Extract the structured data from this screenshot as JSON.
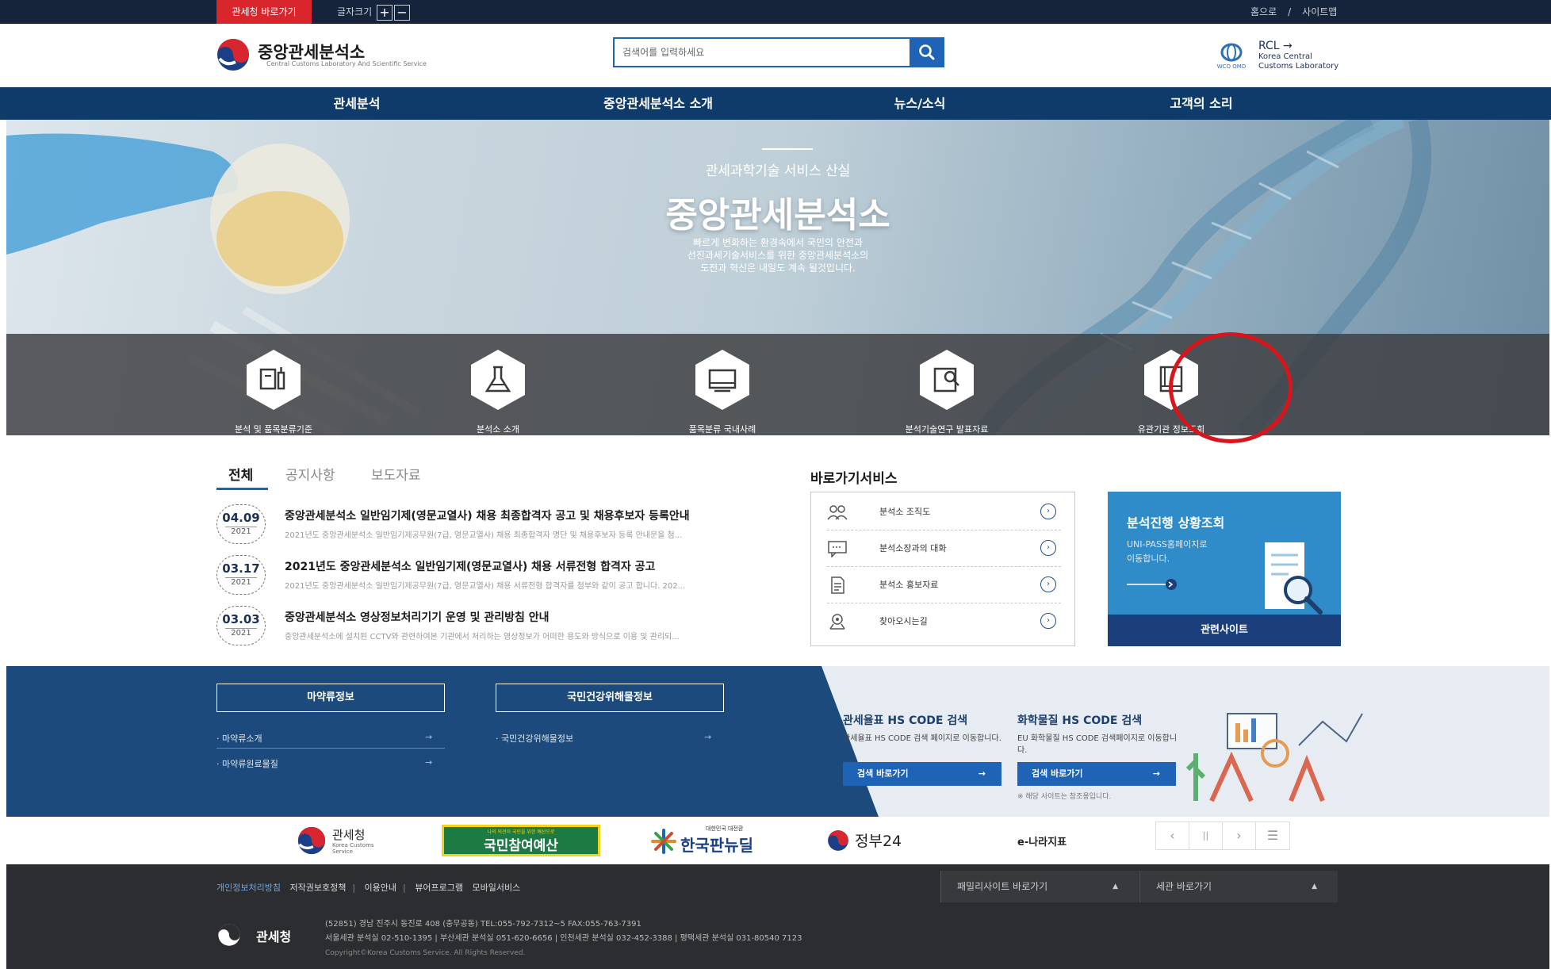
{
  "topbar": {
    "skip_label": "관세청 바로가기",
    "font_size_label": "글자크기",
    "font_plus": "+",
    "font_minus": "−",
    "home_label": "홈으로",
    "separator": "/",
    "sitemap_label": "사이트맵"
  },
  "header": {
    "logo_name": "중앙관세분석소",
    "logo_eng": "Central Customs Laboratory And Scientific Service",
    "search_placeholder": "검색어를 입력하세요",
    "rcl_title": "RCL →",
    "rcl_line1": "Korea Central",
    "rcl_line2": "Customs Laboratory",
    "wco_label": "WCO OMD"
  },
  "gnb": [
    "관세분석",
    "중앙관세분석소 소개",
    "뉴스/소식",
    "고객의 소리"
  ],
  "hero": {
    "subtitle": "관세과학기술 서비스 산실",
    "title": "중앙관세분석소",
    "desc": [
      "빠르게 변화하는 환경속에서 국민의 안전과",
      "선진과세기술서비스를 위한 중앙관세분석소의",
      "도전과 혁신은 내일도 계속 될것입니다."
    ]
  },
  "quick_menu": [
    {
      "label": "분석 및 품목분류기준",
      "icon": "document-bottle-icon"
    },
    {
      "label": "분석소 소개",
      "icon": "flask-icon"
    },
    {
      "label": "품목분류 국내사례",
      "icon": "monitor-icon"
    },
    {
      "label": "분석기술연구 발표자료",
      "icon": "search-document-icon"
    },
    {
      "label": "유관기관 정보조회",
      "icon": "book-icon"
    }
  ],
  "news": {
    "tabs": [
      "전체",
      "공지사항",
      "보도자료"
    ],
    "items": [
      {
        "md": "04.09",
        "year": "2021",
        "title": "중앙관세분석소 일반임기제(영문교열사) 채용 최종합격자 공고 및 채용후보자 등록안내",
        "desc": "2021년도 중앙관세분석소 일반임기제공무원(7급, 영문교열사) 채용 최종합격자 명단 및 채용후보자 등록 안내문을 첨..."
      },
      {
        "md": "03.17",
        "year": "2021",
        "title": "2021년도 중앙관세분석소 일반임기제(영문교열사) 채용 서류전형 합격자 공고",
        "desc": "2021년도 중앙관세분석소 일반임기제공무원(7급, 영문교열사) 채용 서류전형 합격자를 첨부와 같이 공고 합니다. 202..."
      },
      {
        "md": "03.03",
        "year": "2021",
        "title": "중앙관세분석소 영상정보처리기기 운영 및 관리방침 안내",
        "desc": "중앙관세분석소에 설치된 CCTV와 관련하여본 기관에서 처리하는 영상정보가 어떠한 용도와 방식으로 이용 및 관리되..."
      }
    ]
  },
  "shortcut": {
    "title": "바로가기서비스",
    "items": [
      {
        "label": "분석소 조직도",
        "icon": "people-icon"
      },
      {
        "label": "분석소장과의 대화",
        "icon": "chat-icon"
      },
      {
        "label": "분석소 홍보자료",
        "icon": "document-icon"
      },
      {
        "label": "찾아오시는길",
        "icon": "location-icon"
      }
    ],
    "arrow": "›"
  },
  "analysis": {
    "title": "분석진행 상황조회",
    "desc1": "UNI-PASS홈페이지로",
    "desc2": "이동합니다.",
    "button": "관련사이트"
  },
  "band": {
    "drug_title": "마약류정보",
    "drug_links": [
      "마약류소개",
      "마약류원료물질"
    ],
    "health_title": "국민건강위해물정보",
    "health_links": [
      "국민건강위해물정보"
    ],
    "arrow": "→",
    "hs1_title_a": "관세율표 ",
    "hs1_title_b": "HS CODE",
    "hs1_title_c": " 검색",
    "hs1_desc": "관세율표 HS CODE 검색 페이지로 이동합니다.",
    "hs2_title_a": "화학물질 ",
    "hs2_title_b": "HS CODE",
    "hs2_title_c": " 검색",
    "hs2_desc": "EU 화학물질 HS CODE 검색페이지로 이동합니다.",
    "search_btn": "검색 바로가기",
    "note": "※ 해당 사이트는 참조용입니다."
  },
  "partners": {
    "customs_name": "관세청",
    "customs_eng": "Korea Customs Service",
    "budget": "국민참여예산",
    "budget_sub": "나의 의견이 국민을 위한 예산으로",
    "newdeal": "한국판뉴딜",
    "newdeal_sub": "대한민국 대전환",
    "gov24": "정부24",
    "index": "e-나라지표",
    "ctrl_prev": "‹",
    "ctrl_pause": "||",
    "ctrl_next": "›",
    "ctrl_menu": "☰"
  },
  "footer": {
    "links": [
      "개인정보처리방침",
      "저작권보호정책",
      "이용안내",
      "뷰어프로그램",
      "모바일서비스"
    ],
    "sep": "|",
    "family": "패밀리사이트 바로가기",
    "customs": "세관 바로가기",
    "tri": "▲",
    "logo": "관세청",
    "addr1": "(52851) 경남 진주시 동진로 408 (충무공동) TEL:055-792-7312~5 FAX:055-763-7391",
    "addr2": "서울세관 분석실 02-510-1395 | 부산세관 분석실 051-620-6656 | 인천세관 분석실 032-452-3388 | 평택세관 분석실 031-80540 7123",
    "copyright": "Copyright©Korea Customs Service. All Rights Reserved."
  },
  "colors": {
    "primary": "#1e63b5",
    "navy": "#0f3b6b",
    "topbar": "#15243b",
    "accent_red": "#d8262c",
    "analysis_blue": "#2f8cc9",
    "footer": "#2c2d30"
  }
}
